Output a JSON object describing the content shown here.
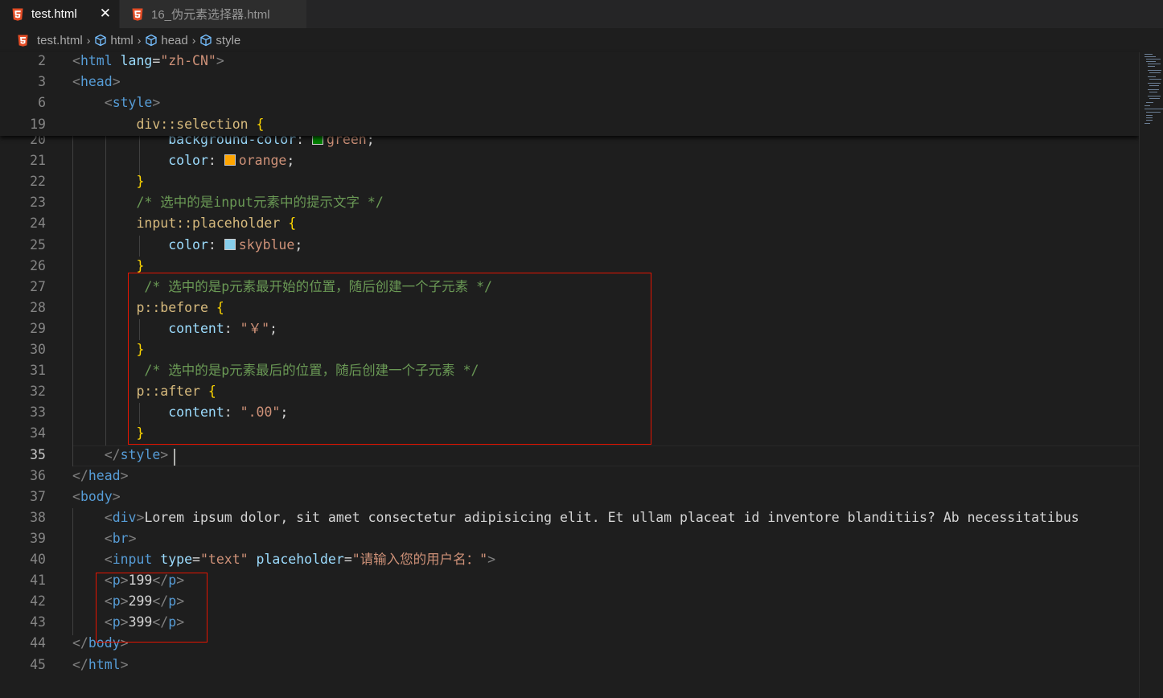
{
  "tabs": [
    {
      "label": "test.html",
      "active": true
    },
    {
      "label": "16_伪元素选择器.html",
      "active": false
    }
  ],
  "breadcrumb": {
    "file": "test.html",
    "items": [
      "html",
      "head",
      "style"
    ]
  },
  "colors": {
    "green": "#008000",
    "orange": "#ffa500",
    "skyblue": "#87ceeb",
    "highlight_box": "#e51400"
  },
  "editor": {
    "current_line": "35",
    "sticky": [
      {
        "num": "2",
        "t": [
          "<",
          "html",
          " ",
          "lang",
          "=",
          "\"zh-CN\"",
          ">"
        ]
      },
      {
        "num": "3",
        "t": [
          "<",
          "head",
          ">"
        ]
      },
      {
        "num": "6",
        "t": [
          "    ",
          "<",
          "style",
          ">"
        ]
      },
      {
        "num": "19",
        "t": [
          "        ",
          "div::selection",
          " ",
          "{"
        ]
      }
    ],
    "lines": [
      {
        "num": "20",
        "t": [
          "            ",
          "background-color",
          ": ",
          "",
          "green",
          ";"
        ]
      },
      {
        "num": "21",
        "t": [
          "            ",
          "color",
          ": ",
          "",
          "orange",
          ";"
        ]
      },
      {
        "num": "22",
        "t": [
          "        ",
          "}"
        ]
      },
      {
        "num": "23",
        "t": [
          "        ",
          "/* 选中的是input元素中的提示文字 */"
        ]
      },
      {
        "num": "24",
        "t": [
          "        ",
          "input::placeholder",
          " ",
          "{"
        ]
      },
      {
        "num": "25",
        "t": [
          "            ",
          "color",
          ": ",
          "",
          "skyblue",
          ";"
        ]
      },
      {
        "num": "26",
        "t": [
          "        ",
          "}"
        ]
      },
      {
        "num": "27",
        "t": [
          "         ",
          "/* 选中的是p元素最开始的位置，随后创建一个子元素 */"
        ]
      },
      {
        "num": "28",
        "t": [
          "        ",
          "p::before",
          " ",
          "{"
        ]
      },
      {
        "num": "29",
        "t": [
          "            ",
          "content",
          ": ",
          "\"￥\"",
          ";"
        ]
      },
      {
        "num": "30",
        "t": [
          "        ",
          "}"
        ]
      },
      {
        "num": "31",
        "t": [
          "         ",
          "/* 选中的是p元素最后的位置，随后创建一个子元素 */"
        ]
      },
      {
        "num": "32",
        "t": [
          "        ",
          "p::after",
          " ",
          "{"
        ]
      },
      {
        "num": "33",
        "t": [
          "            ",
          "content",
          ": ",
          "\".00\"",
          ";"
        ]
      },
      {
        "num": "34",
        "t": [
          "        ",
          "}"
        ]
      },
      {
        "num": "35",
        "t": [
          "    ",
          "</",
          "style",
          ">"
        ]
      },
      {
        "num": "36",
        "t": [
          "</",
          "head",
          ">"
        ]
      },
      {
        "num": "37",
        "t": [
          "<",
          "body",
          ">"
        ]
      },
      {
        "num": "38",
        "t": [
          "    ",
          "<",
          "div",
          ">",
          "Lorem ipsum dolor, sit amet consectetur adipisicing elit. Et ullam placeat id inventore blanditiis? Ab necessitatibus"
        ]
      },
      {
        "num": "39",
        "t": [
          "    ",
          "<",
          "br",
          ">"
        ]
      },
      {
        "num": "40",
        "t": [
          "    ",
          "<",
          "input",
          " ",
          "type",
          "=",
          "\"text\"",
          " ",
          "placeholder",
          "=",
          "\"请输入您的用户名：\"",
          ">"
        ]
      },
      {
        "num": "41",
        "t": [
          "    ",
          "<",
          "p",
          ">",
          "199",
          "</",
          "p",
          ">"
        ]
      },
      {
        "num": "42",
        "t": [
          "    ",
          "<",
          "p",
          ">",
          "299",
          "</",
          "p",
          ">"
        ]
      },
      {
        "num": "43",
        "t": [
          "    ",
          "<",
          "p",
          ">",
          "399",
          "</",
          "p",
          ">"
        ]
      },
      {
        "num": "44",
        "t": [
          "</",
          "body",
          ">"
        ]
      },
      {
        "num": "45",
        "t": [
          "</",
          "html",
          ">"
        ]
      }
    ]
  }
}
